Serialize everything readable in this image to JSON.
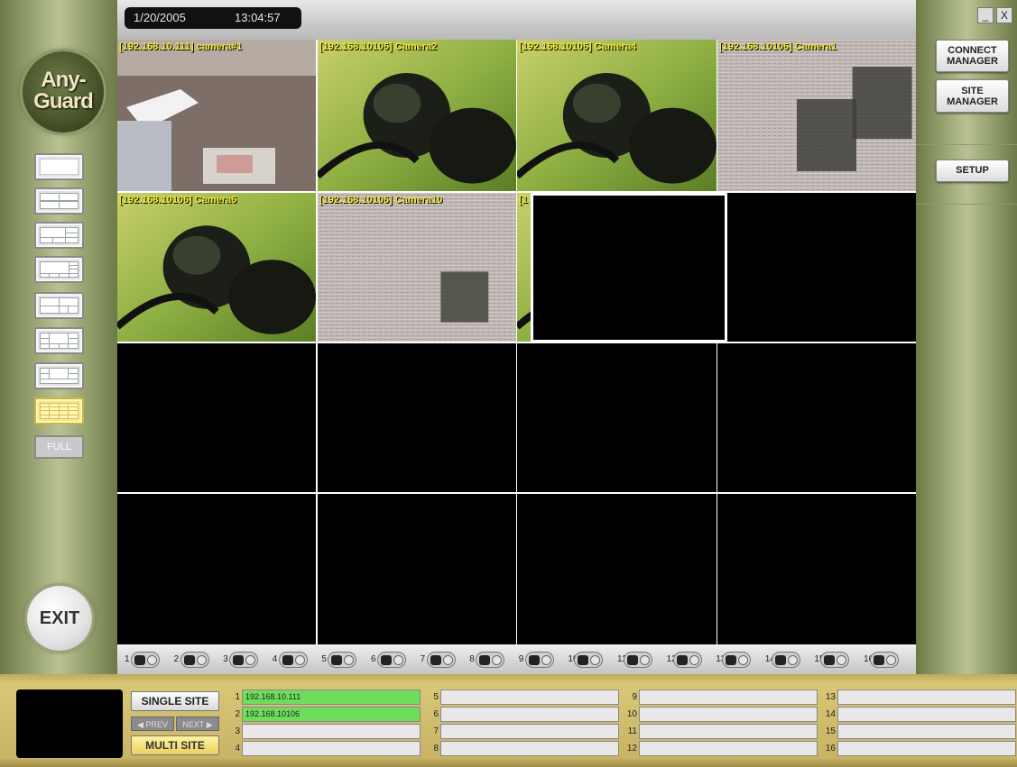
{
  "header": {
    "date": "1/20/2005",
    "time": "13:04:57"
  },
  "logo": {
    "line1": "Any-",
    "line2": "Guard"
  },
  "left_panel": {
    "layouts": [
      "layout-1",
      "layout-4",
      "layout-6",
      "layout-8",
      "layout-9",
      "layout-10",
      "layout-13",
      "layout-16"
    ],
    "active_layout": "layout-16",
    "full_label": "FULL",
    "exit_label": "EXIT"
  },
  "window": {
    "minimize": "_",
    "close": "X"
  },
  "right_panel": {
    "connect_line1": "CONNECT",
    "connect_line2": "MANAGER",
    "site_line1": "SITE",
    "site_line2": "MANAGER",
    "setup": "SETUP"
  },
  "grid": {
    "cells": [
      {
        "label": "[192.168.10.111] camera#1",
        "feed": "office"
      },
      {
        "label": "[192.168.10106] Camera2",
        "feed": "insect"
      },
      {
        "label": "[192.168.10106] Camera4",
        "feed": "insect"
      },
      {
        "label": "[192.168.10106] Camera1",
        "feed": "noise"
      },
      {
        "label": "[192.168.10106] Camera6",
        "feed": "insect"
      },
      {
        "label": "[192.168.10106] Camera10",
        "feed": "noise"
      },
      {
        "label": "[1",
        "feed": "insect"
      },
      {
        "label": "",
        "feed": "black"
      },
      {
        "label": "",
        "feed": "black"
      },
      {
        "label": "",
        "feed": "black"
      },
      {
        "label": "",
        "feed": "black"
      },
      {
        "label": "",
        "feed": "black"
      },
      {
        "label": "",
        "feed": "black"
      },
      {
        "label": "",
        "feed": "black"
      },
      {
        "label": "",
        "feed": "black"
      },
      {
        "label": "",
        "feed": "black"
      }
    ],
    "selected_overlay": "black"
  },
  "camera_bar": {
    "numbers": [
      "1",
      "2",
      "3",
      "4",
      "5",
      "6",
      "7",
      "8",
      "9",
      "10",
      "11",
      "12",
      "13",
      "14",
      "15",
      "16"
    ]
  },
  "bottom": {
    "single_site": "SINGLE SITE",
    "prev": "◀ PREV",
    "next": "NEXT ▶",
    "multi_site": "MULTI SITE",
    "sites": [
      {
        "n": "1",
        "ip": "192.168.10.111",
        "active": true
      },
      {
        "n": "2",
        "ip": "192.168.10106",
        "active": true
      },
      {
        "n": "3",
        "ip": ""
      },
      {
        "n": "4",
        "ip": ""
      },
      {
        "n": "5",
        "ip": ""
      },
      {
        "n": "6",
        "ip": ""
      },
      {
        "n": "7",
        "ip": ""
      },
      {
        "n": "8",
        "ip": ""
      },
      {
        "n": "9",
        "ip": ""
      },
      {
        "n": "10",
        "ip": ""
      },
      {
        "n": "11",
        "ip": ""
      },
      {
        "n": "12",
        "ip": ""
      },
      {
        "n": "13",
        "ip": ""
      },
      {
        "n": "14",
        "ip": ""
      },
      {
        "n": "15",
        "ip": ""
      },
      {
        "n": "16",
        "ip": ""
      }
    ]
  },
  "colors": {
    "label_yellow": "#f2ea3a",
    "site_active": "#6fdd5c",
    "panel_olive": "#a3ad7c"
  }
}
